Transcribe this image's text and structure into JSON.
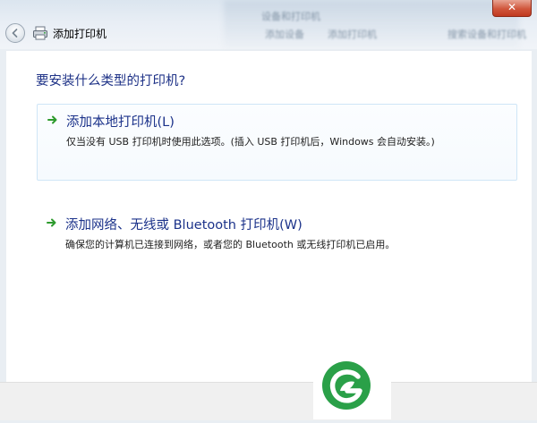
{
  "window": {
    "title": "添加打印机",
    "close_label": "✕",
    "background_hints": [
      "设备和打印机",
      "添加设备",
      "添加打印机",
      "搜索设备和打印机"
    ]
  },
  "page": {
    "question": "要安装什么类型的打印机?"
  },
  "options": [
    {
      "title": "添加本地打印机(L)",
      "description": "仅当没有 USB 打印机时使用此选项。(插入 USB 打印机后，Windows 会自动安装。)"
    },
    {
      "title": "添加网络、无线或 Bluetooth 打印机(W)",
      "description": "确保您的计算机已连接到网络，或者您的 Bluetooth 或无线打印机已启用。"
    }
  ],
  "colors": {
    "accent_text": "#1b328a",
    "arrow_green": "#2e9b2e",
    "logo_green": "#2aa048",
    "selected_border": "#cfe6f7"
  },
  "icons": {
    "back": "back-arrow-icon",
    "printer": "printer-icon",
    "option_arrow": "green-arrow-icon",
    "logo": "green-leaf-logo"
  }
}
